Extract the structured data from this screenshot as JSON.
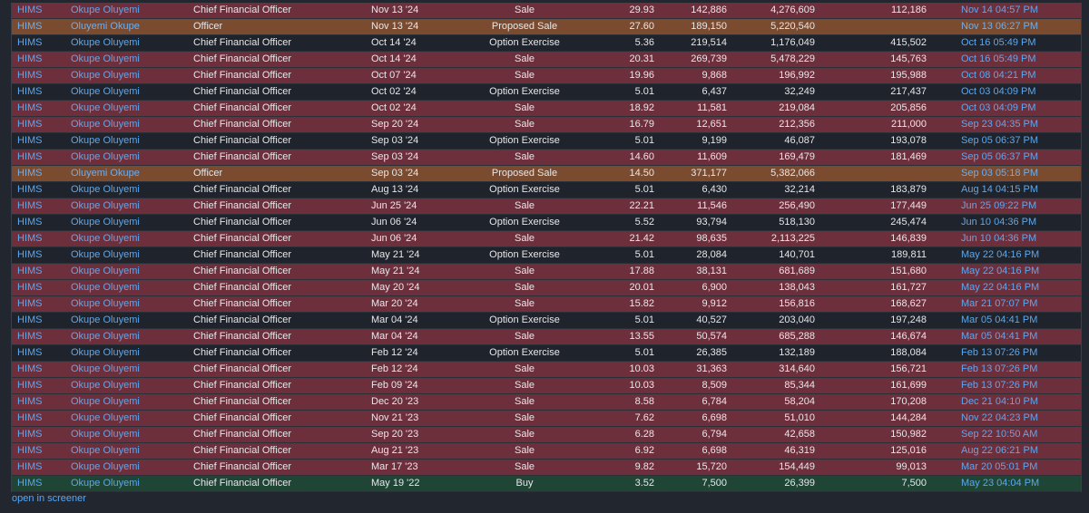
{
  "rows": [
    {
      "ticker": "HIMS",
      "owner": "Okupe Oluyemi",
      "relationship": "Chief Financial Officer",
      "date": "Nov 13 '24",
      "transaction": "Sale",
      "cost": "29.93",
      "shares": "142,886",
      "value": "4,276,609",
      "total": "112,186",
      "filed": "Nov 14 04:57 PM",
      "kind": "sale"
    },
    {
      "ticker": "HIMS",
      "owner": "Oluyemi Okupe",
      "relationship": "Officer",
      "date": "Nov 13 '24",
      "transaction": "Proposed Sale",
      "cost": "27.60",
      "shares": "189,150",
      "value": "5,220,540",
      "total": "",
      "filed": "Nov 13 06:27 PM",
      "kind": "prop"
    },
    {
      "ticker": "HIMS",
      "owner": "Okupe Oluyemi",
      "relationship": "Chief Financial Officer",
      "date": "Oct 14 '24",
      "transaction": "Option Exercise",
      "cost": "5.36",
      "shares": "219,514",
      "value": "1,176,049",
      "total": "415,502",
      "filed": "Oct 16 05:49 PM",
      "kind": "opt"
    },
    {
      "ticker": "HIMS",
      "owner": "Okupe Oluyemi",
      "relationship": "Chief Financial Officer",
      "date": "Oct 14 '24",
      "transaction": "Sale",
      "cost": "20.31",
      "shares": "269,739",
      "value": "5,478,229",
      "total": "145,763",
      "filed": "Oct 16 05:49 PM",
      "kind": "sale"
    },
    {
      "ticker": "HIMS",
      "owner": "Okupe Oluyemi",
      "relationship": "Chief Financial Officer",
      "date": "Oct 07 '24",
      "transaction": "Sale",
      "cost": "19.96",
      "shares": "9,868",
      "value": "196,992",
      "total": "195,988",
      "filed": "Oct 08 04:21 PM",
      "kind": "sale"
    },
    {
      "ticker": "HIMS",
      "owner": "Okupe Oluyemi",
      "relationship": "Chief Financial Officer",
      "date": "Oct 02 '24",
      "transaction": "Option Exercise",
      "cost": "5.01",
      "shares": "6,437",
      "value": "32,249",
      "total": "217,437",
      "filed": "Oct 03 04:09 PM",
      "kind": "opt"
    },
    {
      "ticker": "HIMS",
      "owner": "Okupe Oluyemi",
      "relationship": "Chief Financial Officer",
      "date": "Oct 02 '24",
      "transaction": "Sale",
      "cost": "18.92",
      "shares": "11,581",
      "value": "219,084",
      "total": "205,856",
      "filed": "Oct 03 04:09 PM",
      "kind": "sale"
    },
    {
      "ticker": "HIMS",
      "owner": "Okupe Oluyemi",
      "relationship": "Chief Financial Officer",
      "date": "Sep 20 '24",
      "transaction": "Sale",
      "cost": "16.79",
      "shares": "12,651",
      "value": "212,356",
      "total": "211,000",
      "filed": "Sep 23 04:35 PM",
      "kind": "sale"
    },
    {
      "ticker": "HIMS",
      "owner": "Okupe Oluyemi",
      "relationship": "Chief Financial Officer",
      "date": "Sep 03 '24",
      "transaction": "Option Exercise",
      "cost": "5.01",
      "shares": "9,199",
      "value": "46,087",
      "total": "193,078",
      "filed": "Sep 05 06:37 PM",
      "kind": "opt"
    },
    {
      "ticker": "HIMS",
      "owner": "Okupe Oluyemi",
      "relationship": "Chief Financial Officer",
      "date": "Sep 03 '24",
      "transaction": "Sale",
      "cost": "14.60",
      "shares": "11,609",
      "value": "169,479",
      "total": "181,469",
      "filed": "Sep 05 06:37 PM",
      "kind": "sale"
    },
    {
      "ticker": "HIMS",
      "owner": "Oluyemi Okupe",
      "relationship": "Officer",
      "date": "Sep 03 '24",
      "transaction": "Proposed Sale",
      "cost": "14.50",
      "shares": "371,177",
      "value": "5,382,066",
      "total": "",
      "filed": "Sep 03 05:18 PM",
      "kind": "prop"
    },
    {
      "ticker": "HIMS",
      "owner": "Okupe Oluyemi",
      "relationship": "Chief Financial Officer",
      "date": "Aug 13 '24",
      "transaction": "Option Exercise",
      "cost": "5.01",
      "shares": "6,430",
      "value": "32,214",
      "total": "183,879",
      "filed": "Aug 14 04:15 PM",
      "kind": "opt"
    },
    {
      "ticker": "HIMS",
      "owner": "Okupe Oluyemi",
      "relationship": "Chief Financial Officer",
      "date": "Jun 25 '24",
      "transaction": "Sale",
      "cost": "22.21",
      "shares": "11,546",
      "value": "256,490",
      "total": "177,449",
      "filed": "Jun 25 09:22 PM",
      "kind": "sale"
    },
    {
      "ticker": "HIMS",
      "owner": "Okupe Oluyemi",
      "relationship": "Chief Financial Officer",
      "date": "Jun 06 '24",
      "transaction": "Option Exercise",
      "cost": "5.52",
      "shares": "93,794",
      "value": "518,130",
      "total": "245,474",
      "filed": "Jun 10 04:36 PM",
      "kind": "opt"
    },
    {
      "ticker": "HIMS",
      "owner": "Okupe Oluyemi",
      "relationship": "Chief Financial Officer",
      "date": "Jun 06 '24",
      "transaction": "Sale",
      "cost": "21.42",
      "shares": "98,635",
      "value": "2,113,225",
      "total": "146,839",
      "filed": "Jun 10 04:36 PM",
      "kind": "sale"
    },
    {
      "ticker": "HIMS",
      "owner": "Okupe Oluyemi",
      "relationship": "Chief Financial Officer",
      "date": "May 21 '24",
      "transaction": "Option Exercise",
      "cost": "5.01",
      "shares": "28,084",
      "value": "140,701",
      "total": "189,811",
      "filed": "May 22 04:16 PM",
      "kind": "opt"
    },
    {
      "ticker": "HIMS",
      "owner": "Okupe Oluyemi",
      "relationship": "Chief Financial Officer",
      "date": "May 21 '24",
      "transaction": "Sale",
      "cost": "17.88",
      "shares": "38,131",
      "value": "681,689",
      "total": "151,680",
      "filed": "May 22 04:16 PM",
      "kind": "sale"
    },
    {
      "ticker": "HIMS",
      "owner": "Okupe Oluyemi",
      "relationship": "Chief Financial Officer",
      "date": "May 20 '24",
      "transaction": "Sale",
      "cost": "20.01",
      "shares": "6,900",
      "value": "138,043",
      "total": "161,727",
      "filed": "May 22 04:16 PM",
      "kind": "sale"
    },
    {
      "ticker": "HIMS",
      "owner": "Okupe Oluyemi",
      "relationship": "Chief Financial Officer",
      "date": "Mar 20 '24",
      "transaction": "Sale",
      "cost": "15.82",
      "shares": "9,912",
      "value": "156,816",
      "total": "168,627",
      "filed": "Mar 21 07:07 PM",
      "kind": "sale"
    },
    {
      "ticker": "HIMS",
      "owner": "Okupe Oluyemi",
      "relationship": "Chief Financial Officer",
      "date": "Mar 04 '24",
      "transaction": "Option Exercise",
      "cost": "5.01",
      "shares": "40,527",
      "value": "203,040",
      "total": "197,248",
      "filed": "Mar 05 04:41 PM",
      "kind": "opt"
    },
    {
      "ticker": "HIMS",
      "owner": "Okupe Oluyemi",
      "relationship": "Chief Financial Officer",
      "date": "Mar 04 '24",
      "transaction": "Sale",
      "cost": "13.55",
      "shares": "50,574",
      "value": "685,288",
      "total": "146,674",
      "filed": "Mar 05 04:41 PM",
      "kind": "sale"
    },
    {
      "ticker": "HIMS",
      "owner": "Okupe Oluyemi",
      "relationship": "Chief Financial Officer",
      "date": "Feb 12 '24",
      "transaction": "Option Exercise",
      "cost": "5.01",
      "shares": "26,385",
      "value": "132,189",
      "total": "188,084",
      "filed": "Feb 13 07:26 PM",
      "kind": "opt"
    },
    {
      "ticker": "HIMS",
      "owner": "Okupe Oluyemi",
      "relationship": "Chief Financial Officer",
      "date": "Feb 12 '24",
      "transaction": "Sale",
      "cost": "10.03",
      "shares": "31,363",
      "value": "314,640",
      "total": "156,721",
      "filed": "Feb 13 07:26 PM",
      "kind": "sale"
    },
    {
      "ticker": "HIMS",
      "owner": "Okupe Oluyemi",
      "relationship": "Chief Financial Officer",
      "date": "Feb 09 '24",
      "transaction": "Sale",
      "cost": "10.03",
      "shares": "8,509",
      "value": "85,344",
      "total": "161,699",
      "filed": "Feb 13 07:26 PM",
      "kind": "sale"
    },
    {
      "ticker": "HIMS",
      "owner": "Okupe Oluyemi",
      "relationship": "Chief Financial Officer",
      "date": "Dec 20 '23",
      "transaction": "Sale",
      "cost": "8.58",
      "shares": "6,784",
      "value": "58,204",
      "total": "170,208",
      "filed": "Dec 21 04:10 PM",
      "kind": "sale"
    },
    {
      "ticker": "HIMS",
      "owner": "Okupe Oluyemi",
      "relationship": "Chief Financial Officer",
      "date": "Nov 21 '23",
      "transaction": "Sale",
      "cost": "7.62",
      "shares": "6,698",
      "value": "51,010",
      "total": "144,284",
      "filed": "Nov 22 04:23 PM",
      "kind": "sale"
    },
    {
      "ticker": "HIMS",
      "owner": "Okupe Oluyemi",
      "relationship": "Chief Financial Officer",
      "date": "Sep 20 '23",
      "transaction": "Sale",
      "cost": "6.28",
      "shares": "6,794",
      "value": "42,658",
      "total": "150,982",
      "filed": "Sep 22 10:50 AM",
      "kind": "sale"
    },
    {
      "ticker": "HIMS",
      "owner": "Okupe Oluyemi",
      "relationship": "Chief Financial Officer",
      "date": "Aug 21 '23",
      "transaction": "Sale",
      "cost": "6.92",
      "shares": "6,698",
      "value": "46,319",
      "total": "125,016",
      "filed": "Aug 22 06:21 PM",
      "kind": "sale"
    },
    {
      "ticker": "HIMS",
      "owner": "Okupe Oluyemi",
      "relationship": "Chief Financial Officer",
      "date": "Mar 17 '23",
      "transaction": "Sale",
      "cost": "9.82",
      "shares": "15,720",
      "value": "154,449",
      "total": "99,013",
      "filed": "Mar 20 05:01 PM",
      "kind": "sale"
    },
    {
      "ticker": "HIMS",
      "owner": "Okupe Oluyemi",
      "relationship": "Chief Financial Officer",
      "date": "May 19 '22",
      "transaction": "Buy",
      "cost": "3.52",
      "shares": "7,500",
      "value": "26,399",
      "total": "7,500",
      "filed": "May 23 04:04 PM",
      "kind": "buy"
    }
  ],
  "footer": {
    "link_label": "open in screener"
  },
  "colors": {
    "sale_row": "#6e2f3c",
    "option_row": "#1f232b",
    "proposed_row": "#7a4b2e",
    "buy_row": "#1f4534",
    "link": "#5aa8f0"
  }
}
